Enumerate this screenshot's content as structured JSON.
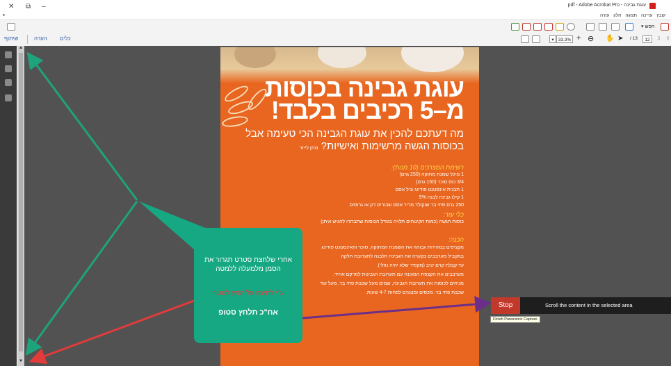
{
  "window": {
    "controls": [
      "✕",
      "⧉",
      "–"
    ],
    "title": "pdf - Adobe Acrobat Pro - עוגת גבינה"
  },
  "menu": {
    "items": [
      "קובץ",
      "עריכה",
      "תצוגה",
      "חלון",
      "עזרה"
    ]
  },
  "toolbar": {
    "tools_label": "כלים",
    "comment_label": "הערה",
    "share_label": "שיתוף",
    "zoom": "33.3%",
    "page_current": "12",
    "page_total": "/ 13",
    "search_label": "חפש"
  },
  "page": {
    "heading_line1": "עוגת גבינה בכוסות",
    "heading_line2": "מ–5 רכיבים בלבד!",
    "intro": "מה דעתכם להכין את עוגת הגבינה הכי טעימה אבל בכוסות הגשה מרשימות ואישיות?",
    "author": "מתן לייזר",
    "ingredients_title": "רשימת המצרכים (10 מנות):",
    "ingredients": [
      "1 מיכל שמנת מתוקה (250 גרם)",
      "3/4 כוס סוכר (150 גרם)",
      "1 תבנית אינסטנט פודינג וניל אסם",
      "1 קילו גבינה לבנה 9%",
      "250 גרם פתי בר שוקולד מריר אסם שבורים דק או גרוסים"
    ],
    "serving_title": "כלי עזר:",
    "serving_line": "כוסות הגשה (כמות הקינוחים תלויה בגודל הכוסות שתבחרו להגיש איתן)",
    "method_title": "הכנה:",
    "method": [
      "מקציפים במהירות גבוהה את השמנת המתוקה, סוכר והאינסטנט פודינג",
      "במקביל מערבבים בקערה את הגבינה הלבנה לתערובת חלקה",
      "עד קבלת קרם יציב (מקפיד שלא יהיה נוזלי).",
      "מערבבים את הקצפת המוכנה עם תערובת הגבינות למרקם אחיד.",
      "מניחים לכוסות את תערובת הגבינה, שמים מעל שכבת פתי בר, מעל עוד",
      "שכבת פתי בר. מכסים ומצננים לפחות 4-7 שעות."
    ]
  },
  "callout": {
    "instruction": "אחרי שלחצת סטרט תגרור את הסמן מלמעלה ללמטה",
    "note": "ע\"י לחיצה על החץ למטה",
    "final": "אח\"כ תלחץ סטופ"
  },
  "capture": {
    "stop_label": "Stop",
    "message": "Scroll the content in the selected area",
    "tooltip": "Finish Panoramic Capture"
  },
  "colors": {
    "page_orange": "#e8661f",
    "callout_green": "#16a882",
    "arrow_green": "#1fa37c",
    "arrow_red": "#e23b3b",
    "arrow_purple": "#6b2f8a",
    "stop_red": "#c0392b"
  }
}
